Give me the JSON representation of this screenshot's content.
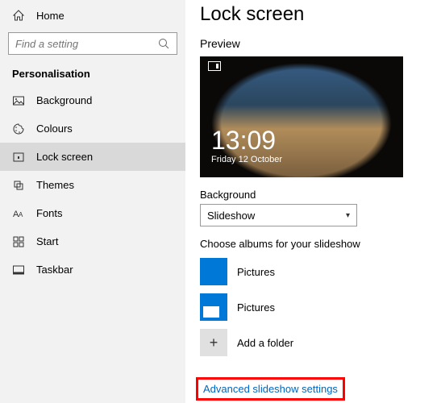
{
  "sidebar": {
    "home": "Home",
    "search_placeholder": "Find a setting",
    "section": "Personalisation",
    "items": [
      {
        "label": "Background"
      },
      {
        "label": "Colours"
      },
      {
        "label": "Lock screen"
      },
      {
        "label": "Themes"
      },
      {
        "label": "Fonts"
      },
      {
        "label": "Start"
      },
      {
        "label": "Taskbar"
      }
    ]
  },
  "main": {
    "title": "Lock screen",
    "preview_label": "Preview",
    "preview": {
      "time": "13:09",
      "date": "Friday 12 October"
    },
    "background_label": "Background",
    "background_value": "Slideshow",
    "albums_label": "Choose albums for your slideshow",
    "albums": [
      {
        "label": "Pictures"
      },
      {
        "label": "Pictures"
      }
    ],
    "add_folder": "Add a folder",
    "advanced_link": "Advanced slideshow settings"
  }
}
